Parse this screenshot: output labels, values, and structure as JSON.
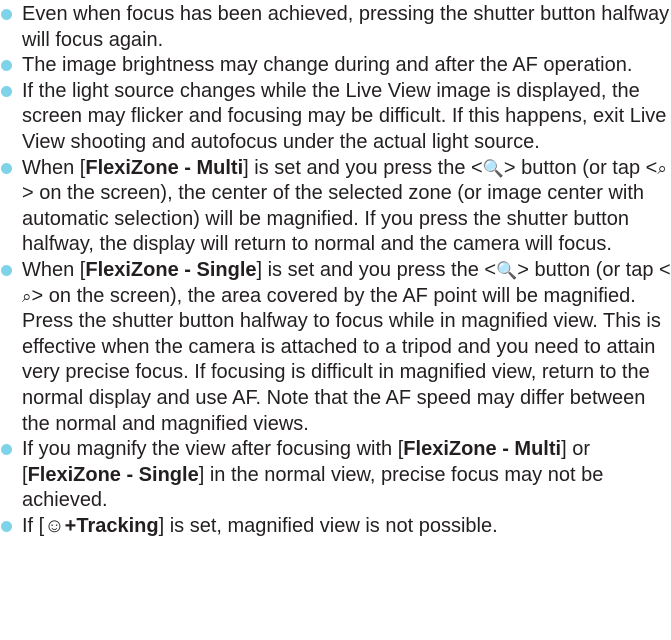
{
  "bullets": {
    "b1": {
      "text": "Even when focus has been achieved, pressing the shutter button halfway will focus again."
    },
    "b2": {
      "text": "The image brightness may change during and after the AF operation."
    },
    "b3": {
      "text": "If the light source changes while the Live View image is displayed, the screen may flicker and focusing may be difficult. If this happens, exit Live View shooting and autofocus under the actual light source."
    },
    "b4": {
      "pre": "When [",
      "bold": "FlexiZone - Multi",
      "mid1": "] is set and you press the <",
      "sym1": "🔍",
      "mid2": "> button (or tap <",
      "sym2": "⌕",
      "post": "> on the screen), the center of the selected zone (or image center with automatic selection) will be magnified. If you press the shutter button halfway, the display will return to normal and the camera will focus."
    },
    "b5": {
      "pre": "When [",
      "bold": "FlexiZone - Single",
      "mid1": "] is set and you press the <",
      "sym1": "🔍",
      "mid2": "> button (or tap <",
      "sym2": "⌕",
      "post": "> on the screen), the area covered by the AF point will be magnified. Press the shutter button halfway to focus while in magnified view. This is effective when the camera is attached to a tripod and you need to attain very precise focus. If focusing is difficult in magnified view, return to the normal display and use AF. Note that the AF speed may differ between the normal and magnified views."
    },
    "b6": {
      "pre": "If you magnify the view after focusing with [",
      "bold1": "FlexiZone - Multi",
      "mid": "] or [",
      "bold2": "FlexiZone - Single",
      "post": "] in the normal view, precise focus may not be achieved."
    },
    "b7": {
      "pre": "If [",
      "symbol": "☺",
      "bold": "+Tracking",
      "post": "] is set, magnified view is not possible."
    }
  },
  "colors": {
    "bullet": "#7fd3e8",
    "text": "#231f20"
  }
}
